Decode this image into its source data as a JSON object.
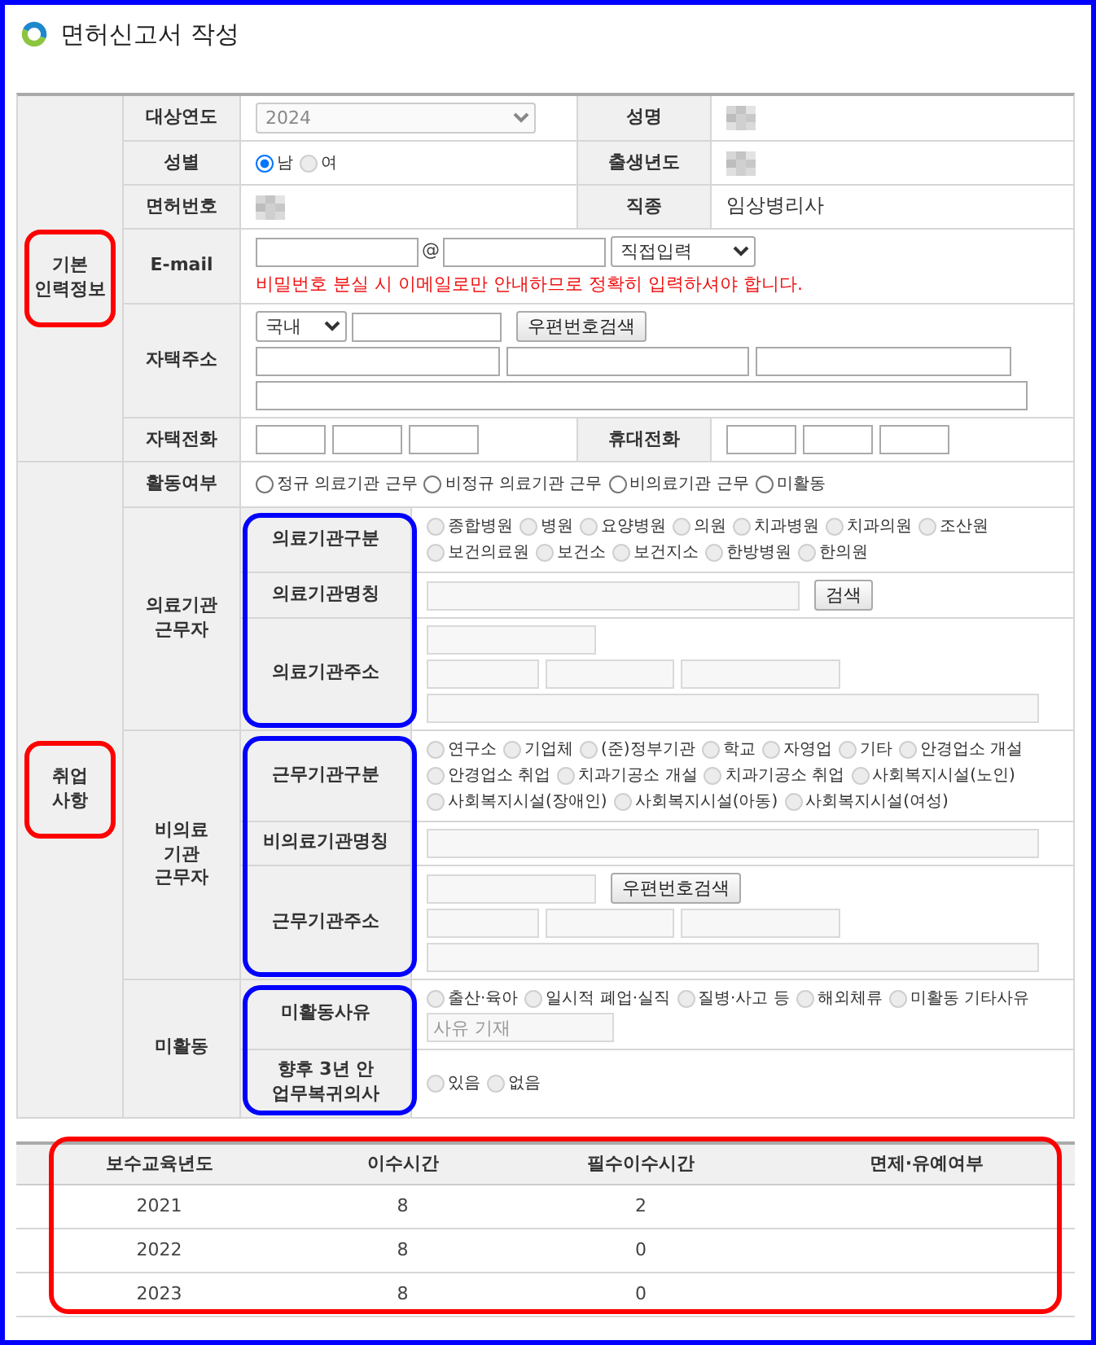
{
  "page_frame": {
    "color": "#0000ff"
  },
  "title": "면허신고서 작성",
  "sections": [
    {
      "label": "기본 인력정보",
      "highlight": {
        "color": "#ff0000"
      },
      "rows": [
        {
          "kind": "fields",
          "cells": [
            {
              "label": "대상연도",
              "field": {
                "kind": "select",
                "value": "2024",
                "disabled": true
              }
            },
            {
              "label": "성명",
              "field": {
                "kind": "blurred"
              }
            }
          ]
        },
        {
          "kind": "fields",
          "cells": [
            {
              "label": "성별",
              "field": {
                "kind": "radios",
                "options": [
                  {
                    "label": "남",
                    "selected": true,
                    "disabled": false
                  },
                  {
                    "label": "여",
                    "selected": false,
                    "disabled": true
                  }
                ]
              }
            },
            {
              "label": "출생년도",
              "field": {
                "kind": "blurred"
              }
            }
          ]
        },
        {
          "kind": "fields",
          "cells": [
            {
              "label": "면허번호",
              "field": {
                "kind": "blurred"
              }
            },
            {
              "label": "직종",
              "field": {
                "kind": "text",
                "value": "임상병리사"
              }
            }
          ]
        },
        {
          "kind": "fields",
          "cells": [
            {
              "label": "E-mail",
              "field": {
                "kind": "email",
                "separator": "@",
                "domain": "직접입력",
                "note": "비밀번호 분실 시 이메일로만 안내하므로 정확히 입력하셔야 합니다."
              }
            }
          ]
        },
        {
          "kind": "fields",
          "cells": [
            {
              "label": "자택주소",
              "field": {
                "kind": "address",
                "country": "국내",
                "button": "우편번호검색",
                "disabled": false
              }
            }
          ]
        },
        {
          "kind": "fields",
          "cells": [
            {
              "label": "자택전화",
              "field": {
                "kind": "phone"
              }
            },
            {
              "label": "휴대전화",
              "field": {
                "kind": "phone"
              }
            }
          ]
        }
      ]
    },
    {
      "label": "취업 사항",
      "highlight": {
        "color": "#ff0000"
      },
      "rows": [
        {
          "kind": "fields",
          "cells": [
            {
              "label": "활동여부",
              "field": {
                "kind": "radios",
                "disabled": false,
                "options": [
                  {
                    "label": "정규 의료기관 근무",
                    "selected": false
                  },
                  {
                    "label": "비정규 의료기관 근무",
                    "selected": false
                  },
                  {
                    "label": "비의료기관 근무",
                    "selected": false
                  },
                  {
                    "label": "미활동",
                    "selected": false
                  }
                ]
              }
            }
          ]
        },
        {
          "kind": "group",
          "label": "의료기관 근무자",
          "highlight": {
            "color": "#0000ff"
          },
          "subrows": [
            {
              "label": "의료기관구분",
              "field": {
                "kind": "radios",
                "disabled": true,
                "options": [
                  {
                    "label": "종합병원",
                    "selected": false
                  },
                  {
                    "label": "병원",
                    "selected": false
                  },
                  {
                    "label": "요양병원",
                    "selected": false
                  },
                  {
                    "label": "의원",
                    "selected": false
                  },
                  {
                    "label": "치과병원",
                    "selected": false
                  },
                  {
                    "label": "치과의원",
                    "selected": false
                  },
                  {
                    "label": "조산원",
                    "selected": false
                  },
                  {
                    "label": "보건의료원",
                    "selected": false
                  },
                  {
                    "label": "보건소",
                    "selected": false
                  },
                  {
                    "label": "보건지소",
                    "selected": false
                  },
                  {
                    "label": "한방병원",
                    "selected": false
                  },
                  {
                    "label": "한의원",
                    "selected": false
                  }
                ]
              }
            },
            {
              "label": "의료기관명칭",
              "field": {
                "kind": "search",
                "button": "검색",
                "disabled": true
              }
            },
            {
              "label": "의료기관주소",
              "field": {
                "kind": "address",
                "disabled": true
              }
            }
          ]
        },
        {
          "kind": "group",
          "label": "비의료 기관 근무자",
          "highlight": {
            "color": "#0000ff"
          },
          "subrows": [
            {
              "label": "근무기관구분",
              "field": {
                "kind": "radios",
                "disabled": true,
                "options": [
                  {
                    "label": "연구소",
                    "selected": false
                  },
                  {
                    "label": "기업체",
                    "selected": false
                  },
                  {
                    "label": "(준)정부기관",
                    "selected": false
                  },
                  {
                    "label": "학교",
                    "selected": false
                  },
                  {
                    "label": "자영업",
                    "selected": false
                  },
                  {
                    "label": "기타",
                    "selected": false
                  },
                  {
                    "label": "안경업소 개설",
                    "selected": false
                  },
                  {
                    "label": "안경업소 취업",
                    "selected": false
                  },
                  {
                    "label": "치과기공소 개설",
                    "selected": false
                  },
                  {
                    "label": "치과기공소 취업",
                    "selected": false
                  },
                  {
                    "label": "사회복지시설(노인)",
                    "selected": false
                  },
                  {
                    "label": "사회복지시설(장애인)",
                    "selected": false
                  },
                  {
                    "label": "사회복지시설(아동)",
                    "selected": false
                  },
                  {
                    "label": "사회복지시설(여성)",
                    "selected": false
                  }
                ]
              }
            },
            {
              "label": "비의료기관명칭",
              "field": {
                "kind": "input",
                "disabled": true
              }
            },
            {
              "label": "근무기관주소",
              "field": {
                "kind": "address",
                "button": "우편번호검색",
                "disabled": true
              }
            }
          ]
        },
        {
          "kind": "group",
          "label": "미활동",
          "highlight": {
            "color": "#0000ff"
          },
          "subrows": [
            {
              "label": "미활동사유",
              "field": {
                "kind": "radios",
                "disabled": true,
                "options": [
                  {
                    "label": "출산·육아",
                    "selected": false
                  },
                  {
                    "label": "일시적 폐업·실직",
                    "selected": false
                  },
                  {
                    "label": "질병·사고 등",
                    "selected": false
                  },
                  {
                    "label": "해외체류",
                    "selected": false
                  },
                  {
                    "label": "미활동 기타사유",
                    "selected": false
                  }
                ],
                "other": {
                  "placeholder": "사유 기재"
                }
              }
            },
            {
              "label": "향후 3년 안 업무복귀의사",
              "field": {
                "kind": "radios",
                "disabled": true,
                "options": [
                  {
                    "label": "있음",
                    "selected": false
                  },
                  {
                    "label": "없음",
                    "selected": false
                  }
                ]
              }
            }
          ]
        }
      ]
    }
  ],
  "education_table": {
    "highlight": {
      "color": "#ff0000"
    },
    "columns": [
      "보수교육년도",
      "이수시간",
      "필수이수시간",
      "면제·유예여부"
    ],
    "rows": [
      [
        "2021",
        "8",
        "2"
      ],
      [
        "2022",
        "8",
        "0"
      ],
      [
        "2023",
        "8",
        "0"
      ]
    ]
  }
}
